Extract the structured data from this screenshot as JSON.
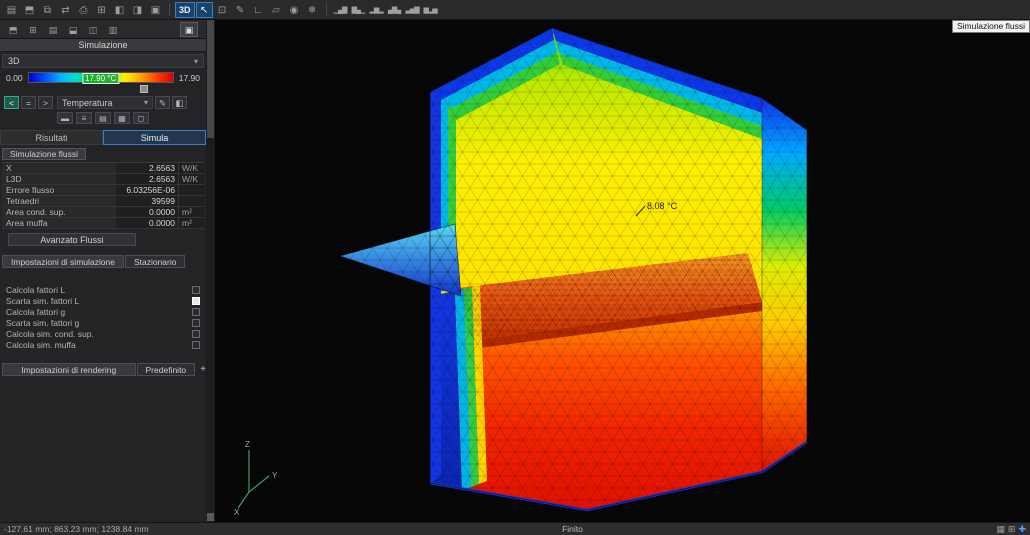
{
  "app": {
    "floating_label": "Simulazione flussi",
    "status": "Finito",
    "coordinates": "-127.61 mm; 863.23 mm; 1238.84 mm"
  },
  "toolbar": {
    "view_3d_label": "3D",
    "file_icons": [
      {
        "name": "new-file",
        "glyph": "▤"
      },
      {
        "name": "open-file",
        "glyph": "⬒"
      },
      {
        "name": "copy",
        "glyph": "⧉"
      },
      {
        "name": "import-export",
        "glyph": "⇄"
      },
      {
        "name": "print",
        "glyph": "⎙"
      },
      {
        "name": "print-preview",
        "glyph": "⊞"
      },
      {
        "name": "panel-left",
        "glyph": "◧"
      },
      {
        "name": "panel-right",
        "glyph": "◨"
      },
      {
        "name": "panel-full",
        "glyph": "▣"
      }
    ],
    "tool_icons": [
      {
        "name": "select-cursor",
        "glyph": "↖"
      },
      {
        "name": "area-select",
        "glyph": "⊡"
      },
      {
        "name": "draw",
        "glyph": "✎"
      },
      {
        "name": "measure-corner",
        "glyph": "∟"
      },
      {
        "name": "cut-plane",
        "glyph": "▱"
      },
      {
        "name": "visibility",
        "glyph": "◉"
      },
      {
        "name": "mesh",
        "glyph": "❄"
      }
    ],
    "chart_icons": [
      {
        "name": "chart-bars",
        "glyph": "▁▄▇"
      },
      {
        "name": "chart-desc",
        "glyph": "▇▄▁"
      },
      {
        "name": "chart-histogram",
        "glyph": "▂▆▂"
      },
      {
        "name": "chart-peak",
        "glyph": "▄▇▄"
      },
      {
        "name": "chart-asc",
        "glyph": "▃▅▇"
      },
      {
        "name": "chart-mixed",
        "glyph": "▆▂▅"
      }
    ]
  },
  "sidebar": {
    "toolbar_icons": [
      {
        "name": "dock-top",
        "glyph": "⬒"
      },
      {
        "name": "dock-grid",
        "glyph": "⊞"
      },
      {
        "name": "dock-rows",
        "glyph": "▤"
      },
      {
        "name": "dock-bottom",
        "glyph": "⬓"
      },
      {
        "name": "dock-split",
        "glyph": "◫"
      },
      {
        "name": "dock-columns",
        "glyph": "▥"
      },
      {
        "name": "dock-active",
        "glyph": "▣"
      }
    ],
    "title": "Simulazione",
    "view_mode": "3D",
    "legend": {
      "min": "0.00",
      "max": "17.90",
      "current": "17.90 °C"
    },
    "compare_buttons": [
      "<",
      "=",
      ">"
    ],
    "quantity": "Temperatura",
    "edit_icons": [
      {
        "name": "edit-scale",
        "glyph": "✎"
      },
      {
        "name": "color-picker",
        "glyph": "◧"
      }
    ],
    "display_icons": [
      {
        "name": "display-solid",
        "glyph": "▬"
      },
      {
        "name": "display-wireframe",
        "glyph": "≡"
      },
      {
        "name": "display-rows",
        "glyph": "▤"
      },
      {
        "name": "display-grid",
        "glyph": "▦"
      },
      {
        "name": "display-transparent",
        "glyph": "◻"
      }
    ],
    "tabs": {
      "results": "Risultati",
      "simulate": "Simula"
    },
    "flux_section": "Simulazione flussi",
    "results": [
      {
        "label": "X",
        "value": "2.6563",
        "unit": "W/K"
      },
      {
        "label": "L3D",
        "value": "2.6563",
        "unit": "W/K"
      },
      {
        "label": "Errore flusso",
        "value": "6.03256E-06",
        "unit": ""
      },
      {
        "label": "Tetraedri",
        "value": "39599",
        "unit": ""
      },
      {
        "label": "Area cond. sup.",
        "value": "0.0000",
        "unit": "m²"
      },
      {
        "label": "Area muffa",
        "value": "0.0000",
        "unit": "m²"
      }
    ],
    "advanced_button": "Avanzato Flussi",
    "settings_tabs": {
      "simulation": "Impostazioni di simulazione",
      "stationary": "Stazionario"
    },
    "options": [
      {
        "label": "Calcola fattori L",
        "checked": false
      },
      {
        "label": "Scarta sim. fattori L",
        "checked": true
      },
      {
        "label": "Calcola fattori g",
        "checked": false
      },
      {
        "label": "Scarta sim. fattori g",
        "checked": false
      },
      {
        "label": "Calcola sim. cond. sup.",
        "checked": false
      },
      {
        "label": "Calcola sim. muffa",
        "checked": false
      }
    ],
    "rendering_tabs": {
      "settings": "Impostazioni di rendering",
      "preset": "Predefinito",
      "add": "+"
    }
  },
  "viewport": {
    "probe_value": "8.08 °C",
    "axes": {
      "x": "X",
      "y": "Y",
      "z": "Z"
    }
  },
  "statusbar_icons": [
    {
      "name": "grid-view",
      "glyph": "▦"
    },
    {
      "name": "table-view",
      "glyph": "⊞"
    },
    {
      "name": "axes-toggle",
      "glyph": "✚"
    }
  ]
}
